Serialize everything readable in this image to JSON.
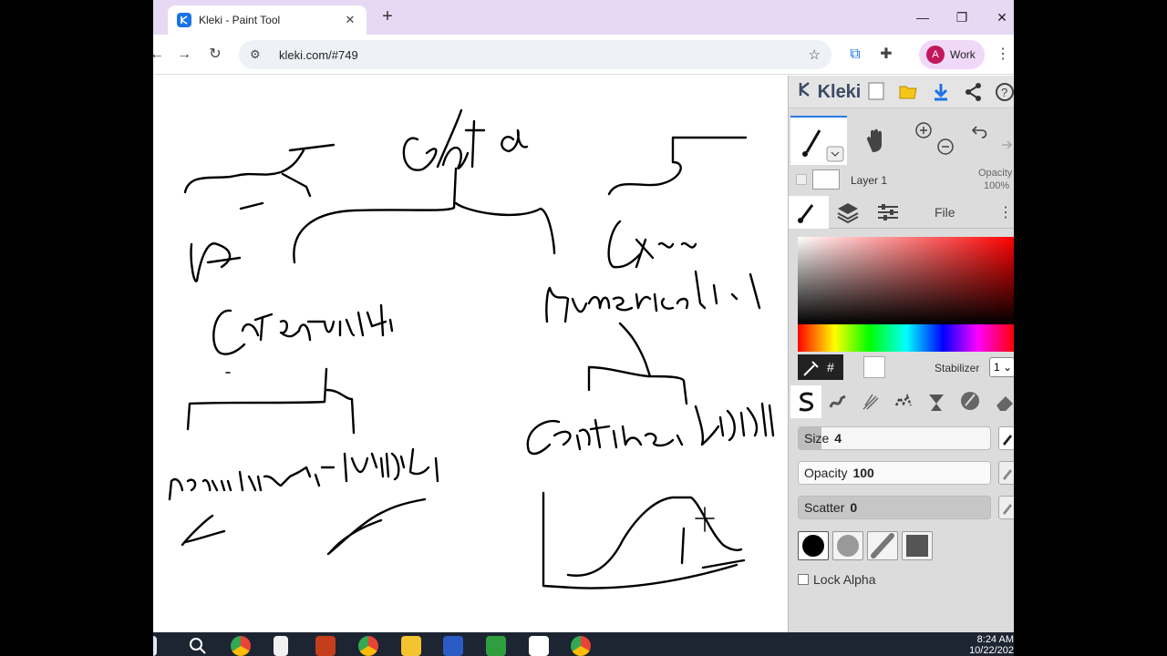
{
  "browser": {
    "tab_title": "Kleki - Paint Tool",
    "url": "kleki.com/#749",
    "profile_initial": "A",
    "profile_label": "Work"
  },
  "kleki": {
    "logo_text": "Kleki",
    "layer_name": "Layer 1",
    "layer_opacity_label": "Opacity",
    "layer_opacity_value": "100%",
    "file_tab": "File",
    "hex_symbol": "#",
    "stabilizer_label": "Stabilizer",
    "stabilizer_value": "1",
    "size_label": "Size",
    "size_value": "4",
    "opacity_label": "Opacity",
    "opacity_value": "100",
    "scatter_label": "Scatter",
    "scatter_value": "0",
    "lock_alpha_label": "Lock Alpha",
    "colors": {
      "accent": "#2a7ae2",
      "primary_color": "#ff0000",
      "secondary_color": "#ffffff"
    }
  },
  "taskbar": {
    "time": "8:24 AM",
    "date": "10/22/202"
  }
}
